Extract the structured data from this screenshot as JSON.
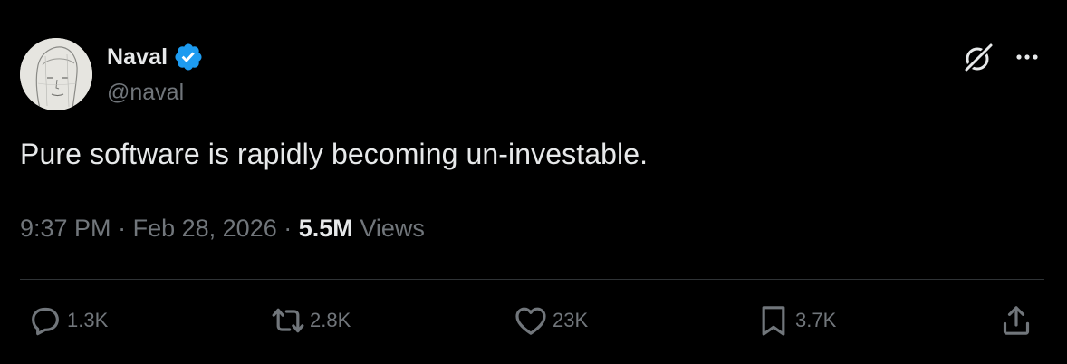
{
  "author": {
    "display_name": "Naval",
    "handle": "@naval",
    "verified": true,
    "verified_color": "#1d9bf0"
  },
  "header_icons": [
    "grok-icon",
    "more-icon"
  ],
  "tweet": {
    "text": "Pure software is rapidly becoming un-investable.",
    "time": "9:37 PM",
    "date": "Feb 28, 2026",
    "separator": "·",
    "views_count": "5.5M",
    "views_label": "Views"
  },
  "actions": {
    "replies": "1.3K",
    "reposts": "2.8K",
    "likes": "23K",
    "bookmarks": "3.7K",
    "share_icon": "share-icon"
  },
  "colors": {
    "background": "#000000",
    "text_primary": "#e7e9ea",
    "text_secondary": "#71767b",
    "divider": "#2f3336"
  }
}
